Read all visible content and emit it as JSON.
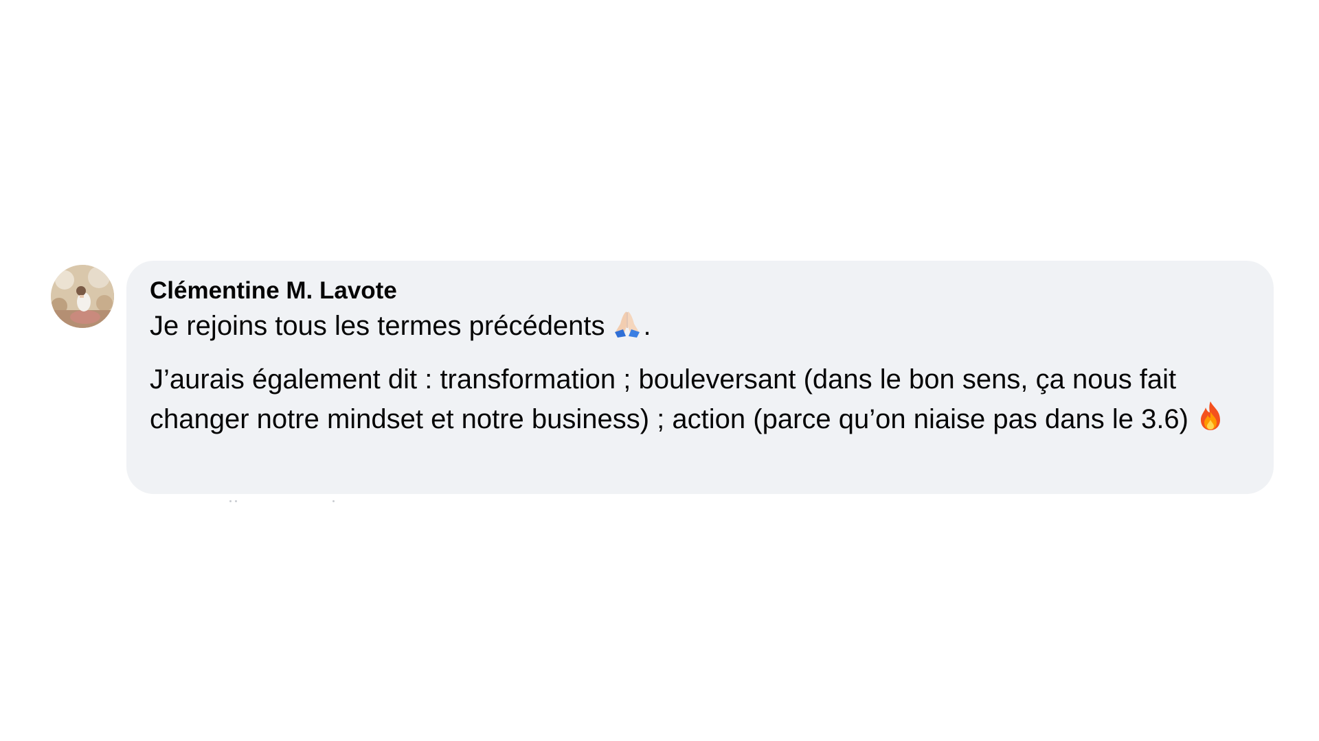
{
  "comment": {
    "author": "Clémentine M. Lavote",
    "avatar_icon": "profile-photo",
    "paragraph1": {
      "text": "Je rejoins tous les termes précédents",
      "emoji": "folded-hands-icon",
      "suffix": "."
    },
    "paragraph2": {
      "text": "J’aurais également dit : transformation ; bouleversant (dans le bon sens, ça nous fait changer notre mindset et notre business) ; action (parce qu’on niaise pas dans le 3.6)",
      "emoji": "fire-icon"
    }
  },
  "colors": {
    "bubble_background": "#f0f2f5",
    "text": "#050505",
    "page_background": "#ffffff"
  }
}
